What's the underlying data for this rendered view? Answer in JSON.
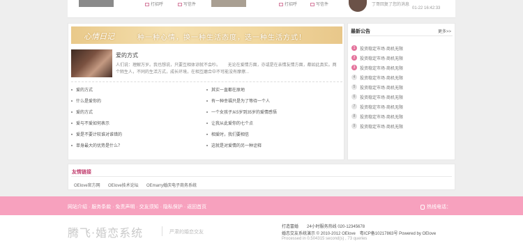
{
  "top_strip": {
    "action_a": "打招呼",
    "action_b": "写信件",
    "action_c": "打招呼",
    "action_d": "写信件",
    "status_line": "丁哥回复了您的消息",
    "date": "01-22 16:42:33"
  },
  "banner": {
    "brand": "心情日记",
    "tagline": "种一种心情，换一种生活态度，选一种生活方式！"
  },
  "article": {
    "title": "爱的方式",
    "body": "人们说：理解万岁。我也想说，只要互相体谅就不会吵。　　 无论在爱情方面，亦或是在亲情友情方面，都如此真实。两个陌生人，不同的生活方式，成长环境，在相互磨合中不可能没有摩擦..."
  },
  "links": {
    "left": [
      "爱的方式",
      "什么是爱你的",
      "爱的方式",
      "爱与不爱如何表示",
      "爱是不要计较谁对谁错的",
      "单身最大的优势是什么？"
    ],
    "right": [
      "其实一直都在原地",
      "有一种幸福只是为了等待一个人",
      "一个女孩子从5岁到35岁的爱情感悟",
      "让我从此爱你的七个点",
      "相爱时，我们要相信",
      "这就是对爱情的另一种诠释"
    ]
  },
  "sidebar": {
    "title": "最新公告",
    "more": "更多>>",
    "items": [
      {
        "num": "1",
        "label": "投资稳定市场·商机无限"
      },
      {
        "num": "2",
        "label": "投资稳定市场·商机无限"
      },
      {
        "num": "3",
        "label": "投资稳定市场·商机无限"
      },
      {
        "num": "4",
        "label": "投资稳定市场·商机无限"
      },
      {
        "num": "5",
        "label": "投资稳定市场·商机无限"
      },
      {
        "num": "6",
        "label": "投资稳定市场·商机无限"
      },
      {
        "num": "7",
        "label": "投资稳定市场·商机无限"
      },
      {
        "num": "8",
        "label": "投资稳定市场·商机无限"
      },
      {
        "num": "9",
        "label": "投资稳定市场·商机无限"
      }
    ]
  },
  "friend_links": {
    "title": "友情链接",
    "items": [
      "OElove官方网",
      "OElove技术论坛",
      "OEmarry婚庆电子商务系统"
    ]
  },
  "pink_nav": {
    "menu": "网站介绍 · 服务条款 · 免责声明 · 交友须知 · 隐私保护 · 返回首页",
    "hotline": "热线电话："
  },
  "footer": {
    "logo": "腾飞·婚恋系统",
    "slogan": "严肃的婚恋交友",
    "line1": "打造富婚　　24小时服务热线 020-12345678",
    "line2": "婚恋交友系统演示 © 2010-2012 OElove　粤ICP备10217863号 Powered by OElove",
    "line3": "Processed in 0.504315 second(s) , 73 queries"
  },
  "colors": {
    "accent_pink": "#f7a1be",
    "title_pink": "#c03d6d",
    "badge_pink": "#e4739c"
  }
}
